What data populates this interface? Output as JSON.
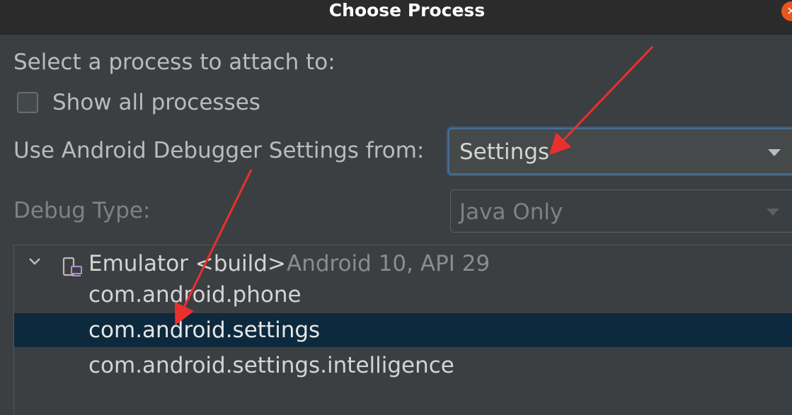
{
  "dialog": {
    "title": "Choose Process",
    "close_glyph": "✕",
    "prompt": "Select a process to attach to:",
    "show_all_label": "Show all processes",
    "show_all_checked": false,
    "settings_label": "Use Android Debugger Settings from:",
    "settings_value": "Settings",
    "debug_type_label": "Debug Type:",
    "debug_type_value": "Java Only"
  },
  "tree": {
    "device": {
      "name": "Emulator <build>",
      "info": "Android 10, API 29",
      "icon": "device-icon",
      "expanded": true
    },
    "processes": [
      {
        "name": "com.android.phone",
        "selected": false
      },
      {
        "name": "com.android.settings",
        "selected": true
      },
      {
        "name": "com.android.settings.intelligence",
        "selected": false
      }
    ]
  },
  "colors": {
    "background": "#3c3f41",
    "titlebar": "#2b2b2b",
    "selection": "#0d293e",
    "focus_border": "#466d94",
    "annotation_arrow": "#e8302e",
    "close_button": "#e95420"
  }
}
